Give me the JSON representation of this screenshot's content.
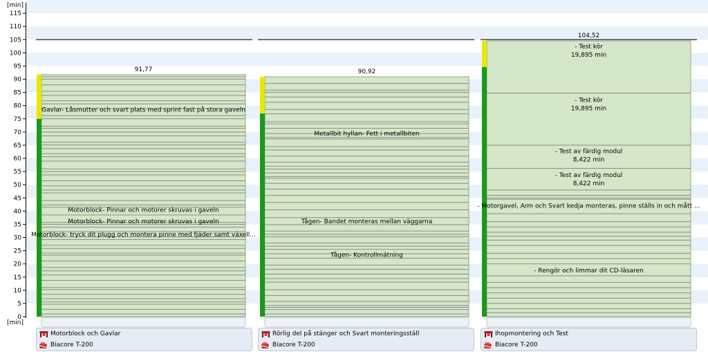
{
  "chart_data": {
    "type": "stacked-bar",
    "unit_top": "[min]",
    "unit_bottom": "[min]",
    "ylim": [
      0,
      120
    ],
    "yticks": [
      0,
      5,
      10,
      15,
      20,
      25,
      30,
      35,
      40,
      45,
      50,
      55,
      60,
      65,
      70,
      75,
      80,
      85,
      90,
      95,
      100,
      105,
      110,
      115
    ],
    "takt_time": 105,
    "colors": {
      "segment_fill": "#d4e7c8",
      "segment_border": "#8fa888",
      "task_line": "#8a8a8a",
      "green_status": "#1a9a1a",
      "yellow_status": "#e8e800",
      "takt_line": "#444444",
      "grid_band": "#e9f1fa"
    },
    "bars": [
      {
        "total_label": "91,77",
        "total": 91.77,
        "green_until": 75,
        "station_name": "Motorblock och Gavlar",
        "product": "Biacore T-200",
        "labels": [
          {
            "text": "Gavlar- Låsmutter och svart plats med sprint fast på stora gaveln",
            "y": 78.5
          },
          {
            "text": "Motorblock- Pinnar och motorer skruvas i gaveln",
            "y": 40.5
          },
          {
            "text": "Motorblock- Pinnar och motorer skruvas i gaveln",
            "y": 36.2
          },
          {
            "text": "Motorblock- tryck dit plugg och montera pinne med fjäder samt växell...",
            "y": 31.2
          }
        ]
      },
      {
        "total_label": "90,92",
        "total": 90.92,
        "green_until": 77,
        "station_name": "Rörlig del på stänger och Svart monteringsställ",
        "product": "Biacore T-200",
        "labels": [
          {
            "text": "Metallbit hyllan- Fett i metallbiten",
            "y": 69.5
          },
          {
            "text": "Tågen- Bandet monteras mellan väggarna",
            "y": 36.2
          },
          {
            "text": "Tågen- Kontrollmätning",
            "y": 23.5
          }
        ]
      },
      {
        "total_label": "104,52",
        "total": 104.52,
        "green_until": 94.6,
        "station_name": "Ihopmontering och Test",
        "product": "Biacore T-200",
        "labels": [
          {
            "text": "- Test kör",
            "y": 102.5
          },
          {
            "text": "19,895 min",
            "y": 99.3
          },
          {
            "text": "- Test kör",
            "y": 82.2
          },
          {
            "text": "19,895 min",
            "y": 79.0
          },
          {
            "text": "- Test av färdig modul",
            "y": 62.7
          },
          {
            "text": "8,422 min",
            "y": 59.6
          },
          {
            "text": "- Test av färdig modul",
            "y": 53.7
          },
          {
            "text": "8,422 min",
            "y": 50.6
          },
          {
            "text": "- Motorgavel, Arm och Svart kedja monteras, pinne ställs in och mått ...",
            "y": 42.0
          },
          {
            "text": "- Rengör och limmar dit CD-läsaren",
            "y": 17.5
          }
        ]
      }
    ]
  }
}
